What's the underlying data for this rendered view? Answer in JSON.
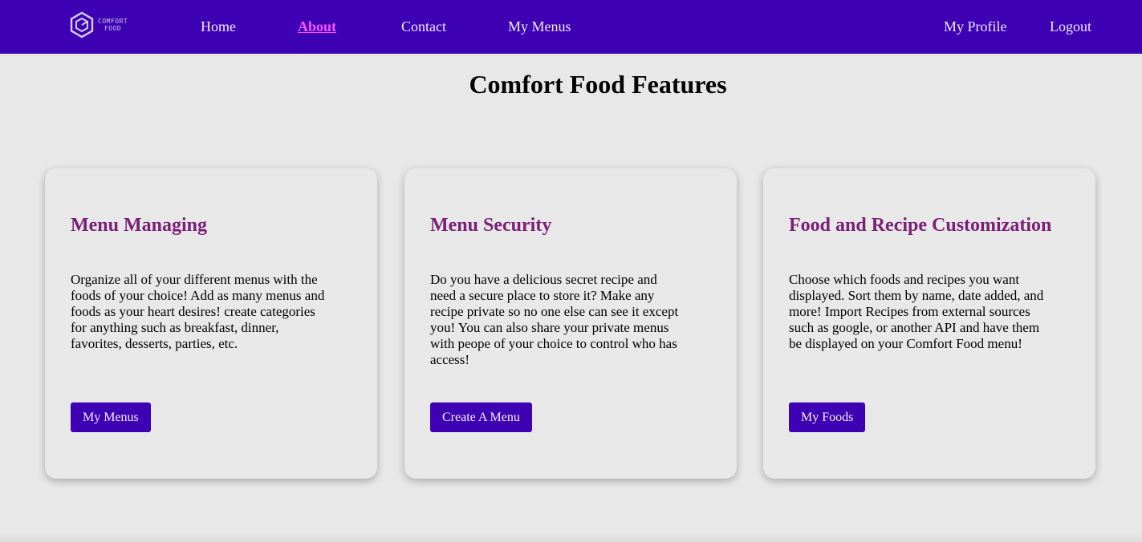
{
  "colors": {
    "nav_bg": "#3d00b3",
    "nav_link": "#f0ecff",
    "nav_active": "#ff55ff",
    "page_bg": "#e8e8e8",
    "card_title": "#7a2076",
    "button_bg": "#3d00b3"
  },
  "logo": {
    "icon": "hexagon-logo-icon",
    "line1": "COMFORT",
    "line2": "FOOD"
  },
  "nav": {
    "home": "Home",
    "about": "About",
    "contact": "Contact",
    "my_menus": "My Menus",
    "my_profile": "My Profile",
    "logout": "Logout",
    "active": "About"
  },
  "page": {
    "title": "Comfort Food Features"
  },
  "cards": [
    {
      "title": "Menu Managing",
      "text": "Organize all of your different menus with the foods of your choice! Add as many menus and foods as your heart desires! create categories for anything such as breakfast, dinner, favorites, desserts, parties, etc.",
      "button": "My Menus"
    },
    {
      "title": "Menu Security",
      "text": "Do you have a delicious secret recipe and need a secure place to store it? Make any recipe private so no one else can see it except you! You can also share your private menus with peope of your choice to control who has access!",
      "button": "Create A Menu"
    },
    {
      "title": "Food and Recipe Customization",
      "text": "Choose which foods and recipes you want displayed. Sort them by name, date added, and more! Import Recipes from external sources such as google, or another API and have them be displayed on your Comfort Food menu!",
      "button": "My Foods"
    }
  ]
}
